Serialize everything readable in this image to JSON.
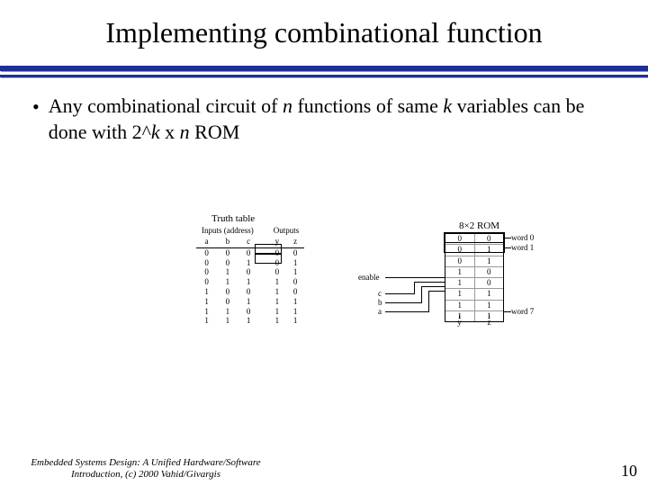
{
  "title": "Implementing combinational function",
  "bullet": {
    "pre": "Any combinational circuit of ",
    "n": "n",
    "mid1": " functions of same ",
    "k": "k",
    "mid2": " variables can be done with 2^",
    "k2": "k",
    "mid3": " x ",
    "n2": "n",
    "post": " ROM"
  },
  "truth_table": {
    "caption": "Truth table",
    "header_inputs": "Inputs (address)",
    "header_outputs": "Outputs",
    "cols_in": [
      "a",
      "b",
      "c"
    ],
    "cols_out": [
      "y",
      "z"
    ],
    "rows": [
      [
        "0",
        "0",
        "0",
        "0",
        "0"
      ],
      [
        "0",
        "0",
        "1",
        "0",
        "1"
      ],
      [
        "0",
        "1",
        "0",
        "0",
        "1"
      ],
      [
        "0",
        "1",
        "1",
        "1",
        "0"
      ],
      [
        "1",
        "0",
        "0",
        "1",
        "0"
      ],
      [
        "1",
        "0",
        "1",
        "1",
        "1"
      ],
      [
        "1",
        "1",
        "0",
        "1",
        "1"
      ],
      [
        "1",
        "1",
        "1",
        "1",
        "1"
      ]
    ]
  },
  "rom": {
    "caption": "8×2 ROM",
    "words": [
      [
        "0",
        "0"
      ],
      [
        "0",
        "1"
      ],
      [
        "0",
        "1"
      ],
      [
        "1",
        "0"
      ],
      [
        "1",
        "0"
      ],
      [
        "1",
        "1"
      ],
      [
        "1",
        "1"
      ],
      [
        "1",
        "1"
      ]
    ],
    "word_labels": {
      "w0": "word 0",
      "w1": "word 1",
      "w7": "word 7"
    },
    "outputs": [
      "y",
      "z"
    ],
    "inputs": {
      "enable": "enable",
      "a": "a",
      "b": "b",
      "c": "c"
    }
  },
  "footer": {
    "source": "Embedded Systems Design: A Unified Hardware/Software Introduction, (c) 2000 Vahid/Givargis",
    "page": "10"
  }
}
